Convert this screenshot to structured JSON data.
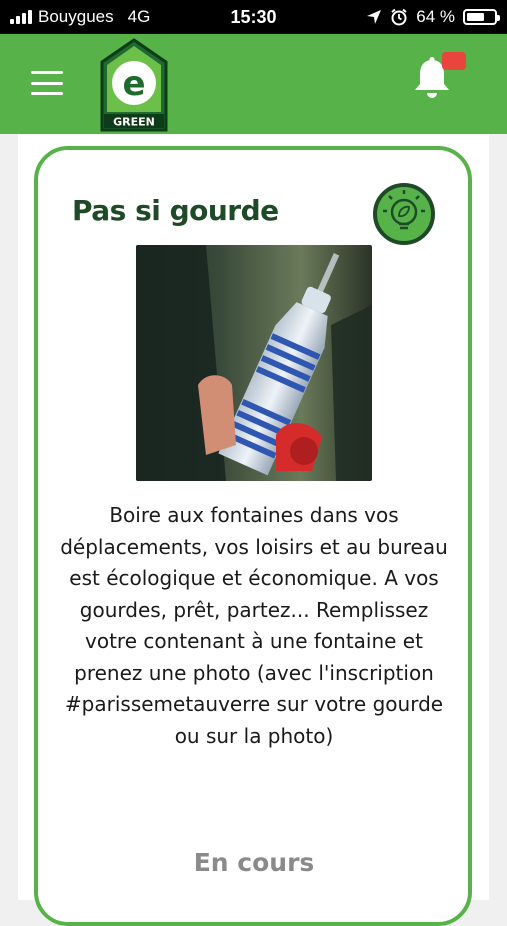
{
  "status_bar": {
    "carrier": "Bouygues",
    "network": "4G",
    "time": "15:30",
    "battery_text": "64 %",
    "battery_level": 0.64,
    "icons": [
      "signal-icon",
      "location-arrow-icon",
      "alarm-clock-icon",
      "battery-icon"
    ]
  },
  "header": {
    "logo_letter": "e",
    "logo_text": "GREEN",
    "menu_icon": "hamburger-menu-icon",
    "notification_icon": "bell-icon",
    "colors": {
      "header_bg": "#58b24a",
      "badge": "#e8453c"
    }
  },
  "challenge": {
    "title": "Pas si gourde",
    "category_icon": "lightbulb-leaf-icon",
    "image_alt": "Hand holding a plastic water bottle filled at a fountain",
    "description": "Boire aux fontaines dans vos déplacements, vos loisirs et au bureau est écologique et économique. A vos gourdes, prêt, partez... Remplissez votre contenant à une fontaine et prenez une photo (avec l'inscription #parissemetauverre sur votre gourde ou sur la photo)",
    "status": "En cours",
    "colors": {
      "card_border": "#58b24a",
      "title": "#1f4a28",
      "status": "#8a8a8a"
    }
  }
}
